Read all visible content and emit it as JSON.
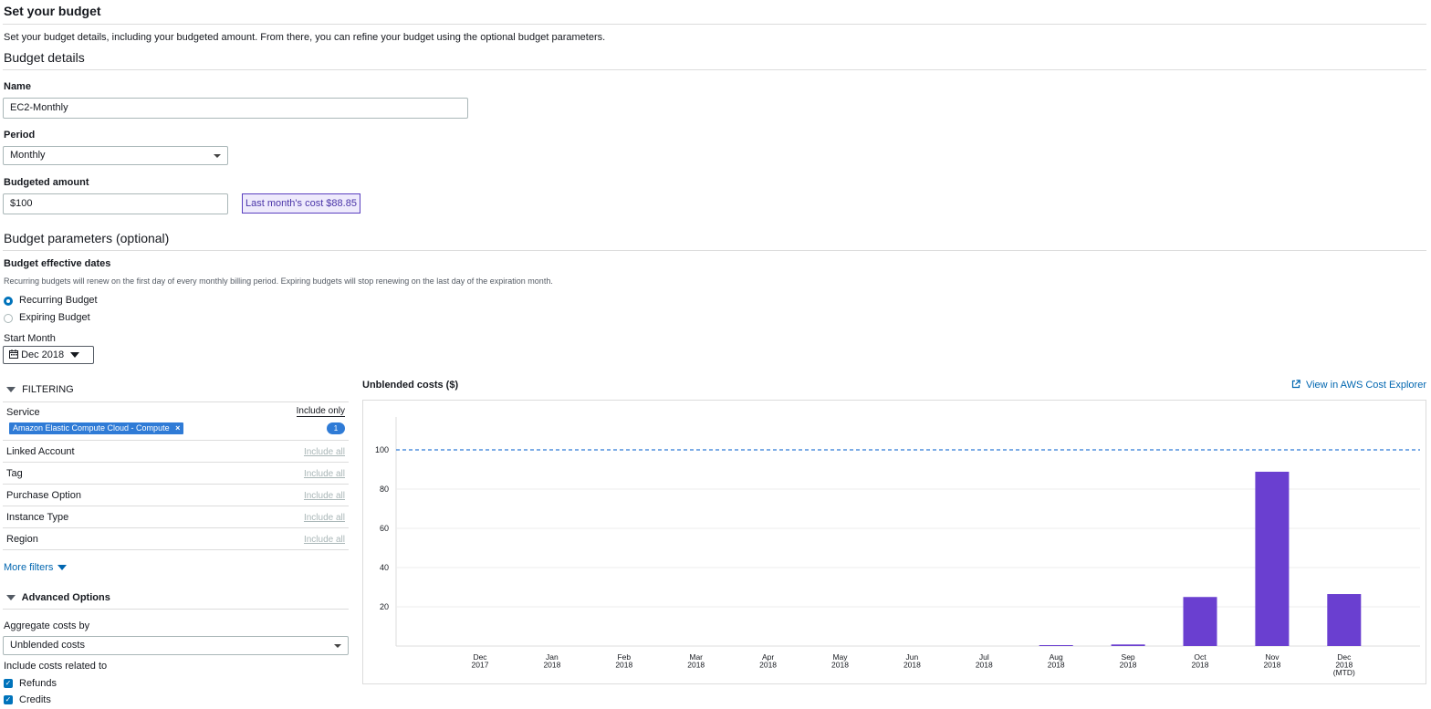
{
  "page": {
    "title": "Set your budget",
    "description": "Set your budget details, including your budgeted amount. From there, you can refine your budget using the optional budget parameters."
  },
  "details": {
    "heading": "Budget details",
    "name_label": "Name",
    "name_value": "EC2-Monthly",
    "period_label": "Period",
    "period_value": "Monthly",
    "amount_label": "Budgeted amount",
    "amount_value": "$100",
    "last_month_cost": "Last month's cost $88.85"
  },
  "parameters": {
    "heading": "Budget parameters (optional)",
    "dates_label": "Budget effective dates",
    "dates_help": "Recurring budgets will renew on the first day of every monthly billing period. Expiring budgets will stop renewing on the last day of the expiration month.",
    "recurring_label": "Recurring Budget",
    "expiring_label": "Expiring Budget",
    "start_month_label": "Start Month",
    "start_month_value": "Dec 2018"
  },
  "filtering": {
    "heading": "FILTERING",
    "service_label": "Service",
    "service_include": "Include only",
    "service_tag": "Amazon Elastic Compute Cloud - Compute",
    "service_tag_close": "×",
    "service_count": "1",
    "rows": [
      {
        "name": "Linked Account",
        "action": "Include all"
      },
      {
        "name": "Tag",
        "action": "Include all"
      },
      {
        "name": "Purchase Option",
        "action": "Include all"
      },
      {
        "name": "Instance Type",
        "action": "Include all"
      },
      {
        "name": "Region",
        "action": "Include all"
      }
    ],
    "more_filters": "More filters"
  },
  "advanced": {
    "heading": "Advanced Options",
    "aggregate_label": "Aggregate costs by",
    "aggregate_value": "Unblended costs",
    "include_label": "Include costs related to",
    "refunds_label": "Refunds",
    "credits_label": "Credits"
  },
  "chart_header": {
    "title": "Unblended costs ($)",
    "explorer_link": "View in AWS Cost Explorer"
  },
  "colors": {
    "bar": "#6a3fd0",
    "threshold": "#2f7bd6",
    "accent_blue": "#0073bb"
  },
  "chart_data": {
    "type": "bar",
    "title": "Unblended costs ($)",
    "categories": [
      [
        "Dec",
        "2017"
      ],
      [
        "Jan",
        "2018"
      ],
      [
        "Feb",
        "2018"
      ],
      [
        "Mar",
        "2018"
      ],
      [
        "Apr",
        "2018"
      ],
      [
        "May",
        "2018"
      ],
      [
        "Jun",
        "2018"
      ],
      [
        "Jul",
        "2018"
      ],
      [
        "Aug",
        "2018"
      ],
      [
        "Sep",
        "2018"
      ],
      [
        "Oct",
        "2018"
      ],
      [
        "Nov",
        "2018"
      ],
      [
        "Dec",
        "2018",
        "(MTD)"
      ]
    ],
    "values": [
      0,
      0,
      0,
      0,
      0,
      0,
      0,
      0,
      0.2,
      0.8,
      25,
      88.85,
      26.5
    ],
    "budget_threshold": 100,
    "yticks": [
      20,
      40,
      60,
      80,
      100
    ],
    "ylim": [
      0,
      115
    ],
    "grid": true
  }
}
